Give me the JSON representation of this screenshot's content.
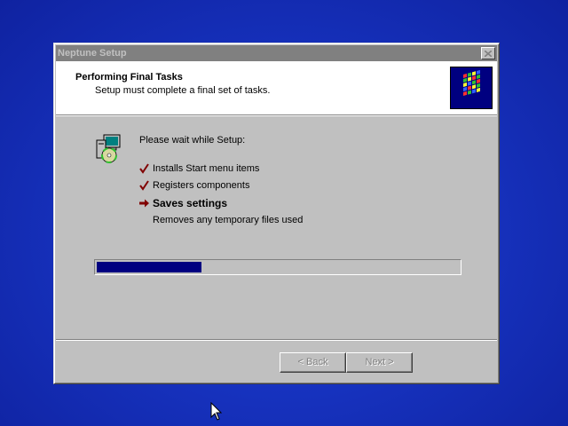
{
  "window": {
    "title": "Neptune Setup"
  },
  "header": {
    "title": "Performing Final Tasks",
    "subtitle": "Setup must complete a final set of tasks."
  },
  "body": {
    "wait_text": "Please wait while Setup:",
    "tasks": [
      {
        "label": "Installs Start menu items",
        "status": "done"
      },
      {
        "label": "Registers components",
        "status": "done"
      },
      {
        "label": "Saves settings",
        "status": "current"
      },
      {
        "label": "Removes any temporary files used",
        "status": "pending"
      }
    ]
  },
  "progress": {
    "fraction": 0.29
  },
  "buttons": {
    "back_label": "< Back",
    "next_label": "Next >"
  },
  "colors": {
    "accent": "#000080",
    "check": "#800000",
    "desktop": "#1733c0"
  },
  "icons": {
    "close": "close-icon",
    "logo": "setup-logo-icon",
    "setup": "computer-cd-icon",
    "done": "checkmark-icon",
    "current": "arrow-right-icon"
  }
}
